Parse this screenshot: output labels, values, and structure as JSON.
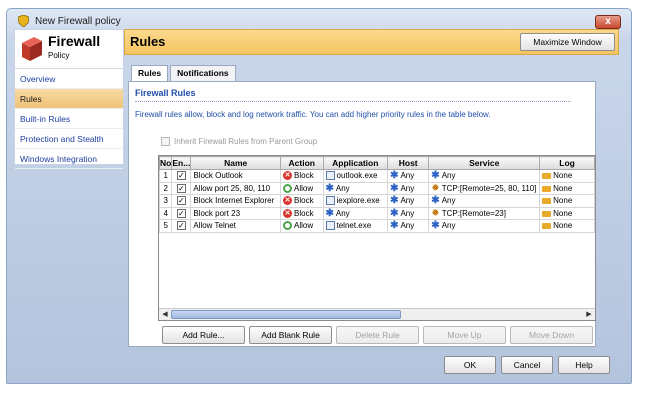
{
  "window": {
    "title": "New Firewall policy",
    "close_label": "x"
  },
  "brand": {
    "name": "Firewall",
    "sub": "Policy"
  },
  "nav": {
    "items": [
      {
        "label": "Overview",
        "active": false
      },
      {
        "label": "Rules",
        "active": true
      },
      {
        "label": "Built-in Rules",
        "active": false
      },
      {
        "label": "Protection and Stealth",
        "active": false
      },
      {
        "label": "Windows Integration",
        "active": false
      }
    ]
  },
  "header": {
    "title": "Rules",
    "maximize_label": "Maximize Window"
  },
  "tabs": [
    {
      "label": "Rules",
      "active": true
    },
    {
      "label": "Notifications",
      "active": false
    }
  ],
  "section": {
    "title": "Firewall Rules",
    "description": "Firewall rules allow, block and log network traffic. You can add higher priority rules in the table below.",
    "inherit_label": "Inherit Firewall Rules from Parent Group"
  },
  "table": {
    "columns": [
      "No",
      "En...",
      "Name",
      "Action",
      "Application",
      "Host",
      "Service",
      "Log"
    ],
    "rows": [
      {
        "no": "1",
        "enabled": true,
        "name": "Block Outlook",
        "action": "Block",
        "app": "outlook.exe",
        "host": "Any",
        "service": "Any",
        "service_type": "any",
        "log": "None"
      },
      {
        "no": "2",
        "enabled": true,
        "name": "Allow port 25, 80, 110",
        "action": "Allow",
        "app": "Any",
        "host": "Any",
        "service": "TCP:[Remote=25, 80, 110]",
        "service_type": "tcp",
        "log": "None"
      },
      {
        "no": "3",
        "enabled": true,
        "name": "Block Internet Explorer",
        "action": "Block",
        "app": "iexplore.exe",
        "host": "Any",
        "service": "Any",
        "service_type": "any",
        "log": "None"
      },
      {
        "no": "4",
        "enabled": true,
        "name": "Block port 23",
        "action": "Block",
        "app": "Any",
        "host": "Any",
        "service": "TCP:[Remote=23]",
        "service_type": "tcp",
        "log": "None"
      },
      {
        "no": "5",
        "enabled": true,
        "name": "Allow Telnet",
        "action": "Allow",
        "app": "telnet.exe",
        "host": "Any",
        "service": "Any",
        "service_type": "any",
        "log": "None"
      }
    ]
  },
  "actions": [
    {
      "label": "Add Rule...",
      "enabled": true
    },
    {
      "label": "Add Blank Rule",
      "enabled": true
    },
    {
      "label": "Delete Rule",
      "enabled": false
    },
    {
      "label": "Move Up",
      "enabled": false
    },
    {
      "label": "Move Down",
      "enabled": false
    }
  ],
  "footer": {
    "ok": "OK",
    "cancel": "Cancel",
    "help": "Help"
  },
  "colors": {
    "header_bg": "#f6c460",
    "nav_active": "#efc276",
    "link": "#1f4fa8",
    "block": "#d9342b",
    "allow": "#4aa44a"
  }
}
